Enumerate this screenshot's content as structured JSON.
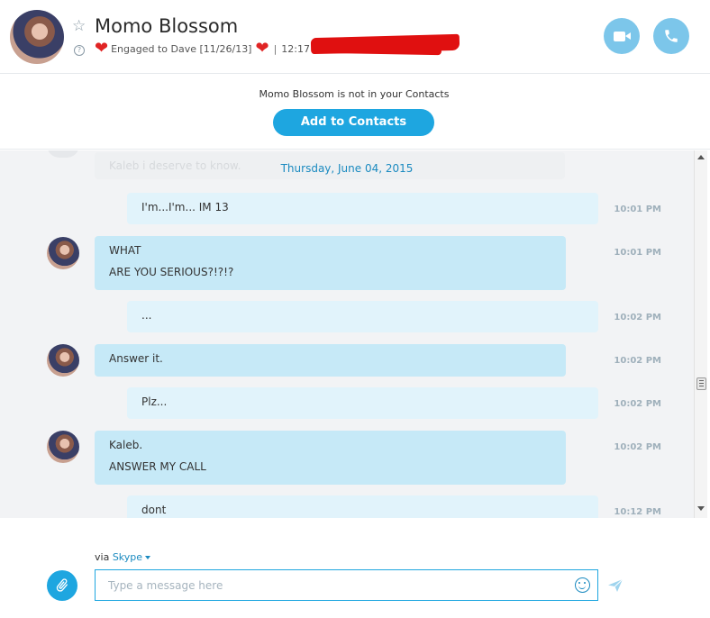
{
  "header": {
    "contact_name": "Momo Blossom",
    "mood_text": "Engaged to Dave [11/26/13]",
    "separator": "|",
    "local_time": "12:17 P"
  },
  "contact_bar": {
    "notice": "Momo Blossom is not in your Contacts",
    "add_label": "Add to Contacts"
  },
  "chat": {
    "ghost_text": "Kaleb i deserve to know.",
    "date": "Thursday, June 04, 2015",
    "messages": [
      {
        "direction": "out",
        "lines": [
          "I'm...I'm... IM 13"
        ],
        "time": "10:01 PM"
      },
      {
        "direction": "in",
        "lines": [
          "WHAT",
          "ARE YOU SERIOUS?!?!?"
        ],
        "time": "10:01 PM"
      },
      {
        "direction": "out",
        "lines": [
          "..."
        ],
        "time": "10:02 PM"
      },
      {
        "direction": "in",
        "lines": [
          "Answer it."
        ],
        "time": "10:02 PM"
      },
      {
        "direction": "out",
        "lines": [
          "Plz..."
        ],
        "time": "10:02 PM"
      },
      {
        "direction": "in",
        "lines": [
          "Kaleb.",
          "ANSWER MY CALL"
        ],
        "time": "10:02 PM"
      },
      {
        "direction": "out",
        "lines": [
          "dont"
        ],
        "time": "10:12 PM"
      }
    ]
  },
  "composer": {
    "via_prefix": "via",
    "via_service": "Skype",
    "placeholder": "Type a message here"
  },
  "icons": {
    "star": "star-icon",
    "help": "help-icon",
    "heart": "heart-icon",
    "video": "video-call-icon",
    "phone": "phone-call-icon",
    "attach": "paperclip-icon",
    "emoji": "emoticon-icon",
    "send": "send-icon"
  },
  "colors": {
    "accent": "#1ea6e0",
    "call_buttons": "#7cc6ea",
    "incoming_bubble": "#c6e9f7",
    "outgoing_bubble": "#e1f3fb",
    "heart": "#e02424",
    "redaction": "#e01010"
  }
}
